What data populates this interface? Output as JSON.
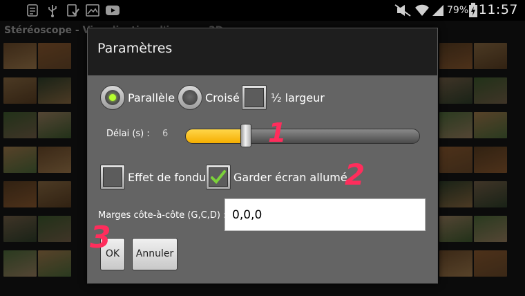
{
  "status_bar": {
    "notification_icons": [
      "notes-icon",
      "usb-icon",
      "download-done-icon",
      "gallery-icon",
      "youtube-icon"
    ],
    "system_icons": [
      "mute-icon",
      "wifi-icon",
      "signal-icon",
      "battery-charging-icon"
    ],
    "battery": "79%",
    "time": "11:57"
  },
  "app": {
    "title": "Stéréoscope - Visualisation d'images 3D"
  },
  "dialog": {
    "title": "Paramètres",
    "mode": {
      "parallel_label": "Parallèle",
      "crossed_label": "Croisé",
      "half_width_label": "½ largeur",
      "selected": "parallel",
      "half_width_checked": false
    },
    "delay": {
      "label": "Délai (s) :",
      "value": "6",
      "fill_fraction": 0.26
    },
    "fade": {
      "label": "Effet de fondu",
      "checked": false
    },
    "keep_screen_on": {
      "label": "Garder écran allumé",
      "checked": true
    },
    "margins": {
      "label": "Marges côte-à-côte (G,C,D) :",
      "value": "0,0,0"
    },
    "ok_label": "OK",
    "cancel_label": "Annuler"
  },
  "annotations": [
    "1",
    "2",
    "3"
  ],
  "colors": {
    "accent_yellow": "#f5ae00",
    "radio_dot": "#b6ff2f",
    "check_green": "#7bd13a",
    "annotation_red": "#ff2d5c"
  }
}
